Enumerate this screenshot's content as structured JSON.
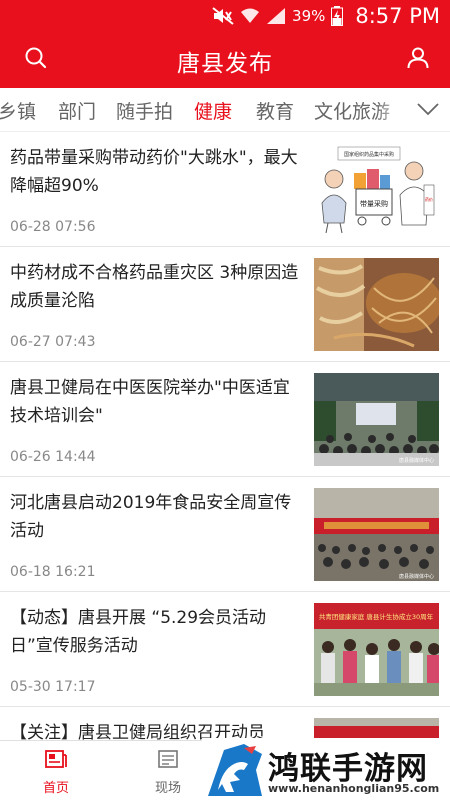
{
  "status_bar": {
    "battery": "39%",
    "time": "8:57 PM"
  },
  "app_bar": {
    "title": "唐县发布",
    "left_icon": "search-icon",
    "right_icon": "user-icon"
  },
  "tabs": [
    {
      "label": "乡镇",
      "active": false
    },
    {
      "label": "部门",
      "active": false
    },
    {
      "label": "随手拍",
      "active": false
    },
    {
      "label": "健康",
      "active": true
    },
    {
      "label": "教育",
      "active": false
    },
    {
      "label": "文化旅游",
      "active": false
    }
  ],
  "tabs_more_icon": "chevron-down-icon",
  "news": [
    {
      "headline": "药品带量采购带动药价\"大跳水\"，最大降幅超90%",
      "time": "06-28 07:56",
      "thumb_text": [
        "国家组织药品集中采购",
        "带量采购",
        "药价"
      ]
    },
    {
      "headline": "中药材成不合格药品重灾区 3种原因造成质量沦陷",
      "time": "06-27 07:43"
    },
    {
      "headline": "唐县卫健局在中医医院举办\"中医适宜技术培训会\"",
      "time": "06-26 14:44",
      "thumb_text": [
        "唐县融媒体中心"
      ]
    },
    {
      "headline": "河北唐县启动2019年食品安全周宣传活动",
      "time": "06-18 16:21",
      "thumb_text": [
        "唐县融媒体中心"
      ]
    },
    {
      "headline": "【动态】唐县开展 “5.29会员活动日”宣传服务活动",
      "time": "05-30 17:17",
      "thumb_text": [
        "共青团健康家庭 唐县计生协成立30周年"
      ]
    },
    {
      "headline": "【关注】唐县卫健局组织召开动员",
      "time": ""
    }
  ],
  "bottom_nav": [
    {
      "label": "首页",
      "icon": "news-icon",
      "active": true
    },
    {
      "label": "现场",
      "icon": "live-icon",
      "active": false
    }
  ],
  "watermark": {
    "name": "鸿联手游网",
    "url": "www.henanhonglian95.com"
  },
  "colors": {
    "brand_red": "#e8101c"
  }
}
